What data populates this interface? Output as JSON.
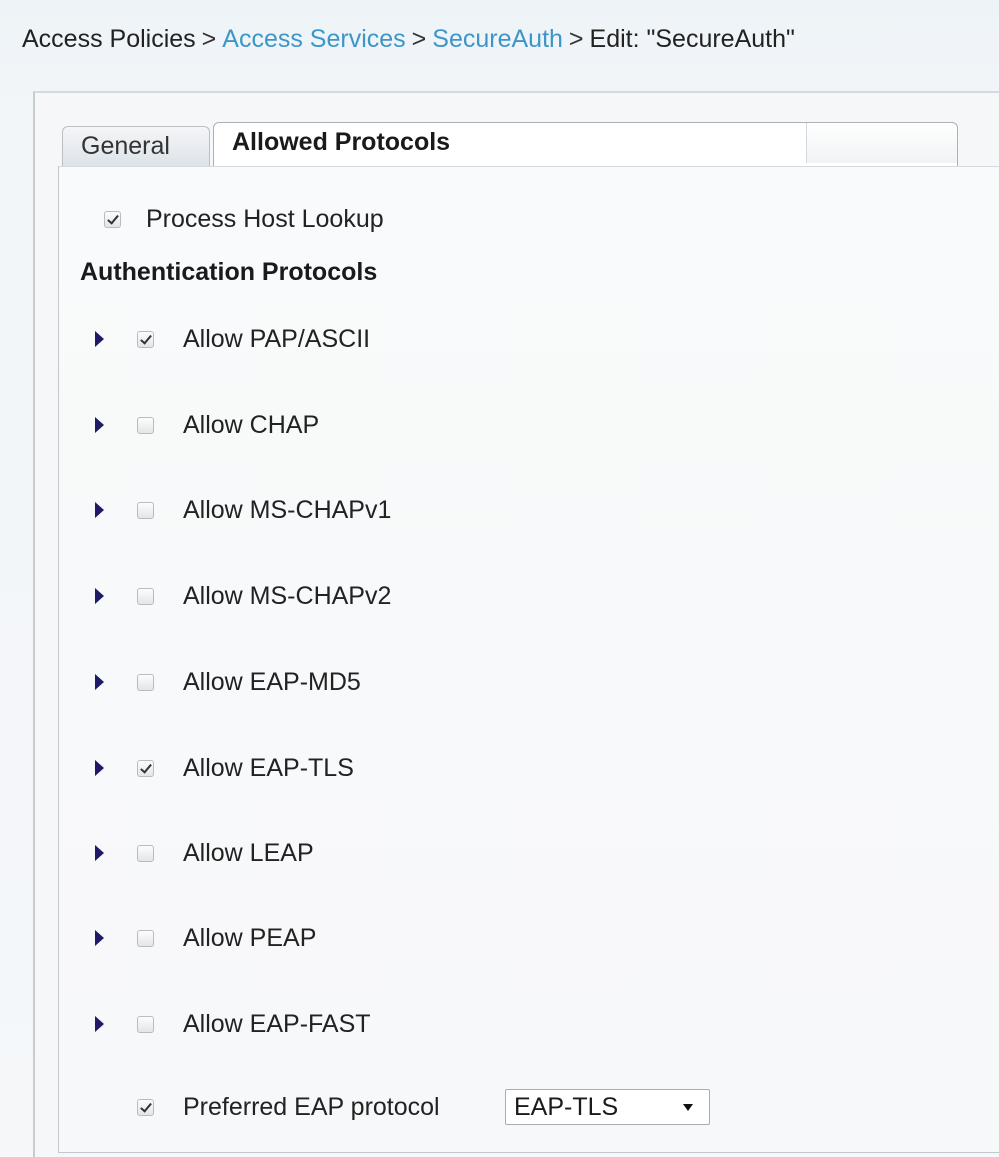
{
  "breadcrumb": {
    "items": [
      "Access Policies",
      "Access Services",
      "SecureAuth",
      "Edit: \"SecureAuth\""
    ],
    "separator": ">"
  },
  "tabs": {
    "general": "General",
    "allowed_protocols": "Allowed Protocols",
    "active": "Allowed Protocols"
  },
  "process_host_lookup": {
    "label": "Process Host Lookup",
    "checked": true
  },
  "authentication_protocols": {
    "heading": "Authentication Protocols",
    "items": [
      {
        "label": "Allow PAP/ASCII",
        "checked": true
      },
      {
        "label": "Allow CHAP",
        "checked": false
      },
      {
        "label": "Allow MS-CHAPv1",
        "checked": false
      },
      {
        "label": "Allow MS-CHAPv2",
        "checked": false
      },
      {
        "label": "Allow EAP-MD5",
        "checked": false
      },
      {
        "label": "Allow EAP-TLS",
        "checked": true
      },
      {
        "label": "Allow LEAP",
        "checked": false
      },
      {
        "label": "Allow PEAP",
        "checked": false
      },
      {
        "label": "Allow EAP-FAST",
        "checked": false
      }
    ]
  },
  "preferred_eap": {
    "label": "Preferred EAP protocol",
    "checked": true,
    "selected": "EAP-TLS"
  },
  "colors": {
    "link": "#3d96c8",
    "expand_arrow": "#1e1a66"
  },
  "icons": {
    "expand": "triangle-right-icon",
    "select_caret": "chevron-down-icon"
  }
}
